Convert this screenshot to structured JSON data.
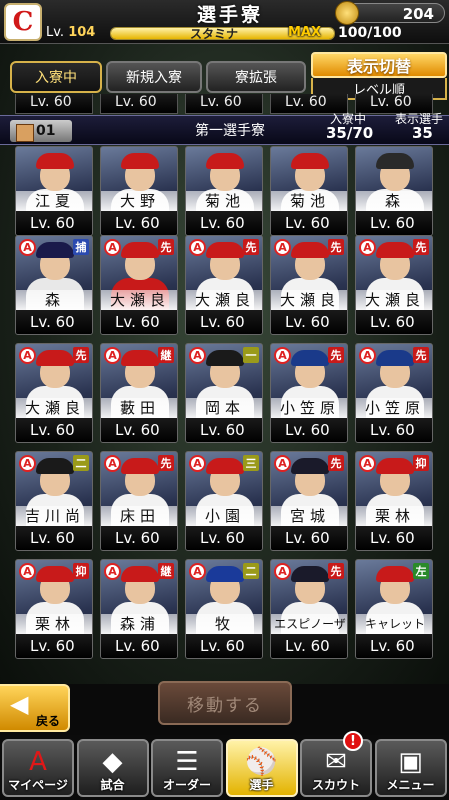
{
  "header": {
    "title": "選手寮",
    "coins": "204",
    "level_label": "Lv.",
    "level_value": "104",
    "stamina_label": "スタミナ",
    "stamina_max_label": "MAX",
    "stamina_value": "100/100",
    "stamina_fraction": 1.0
  },
  "tabs": [
    {
      "label": "入寮中",
      "active": true
    },
    {
      "label": "新規入寮",
      "active": false
    },
    {
      "label": "寮拡張",
      "active": false
    }
  ],
  "display_toggle": {
    "label": "表示切替",
    "sort": "レベル順"
  },
  "previous_row_levels": [
    "Lv. 60",
    "Lv. 60",
    "Lv. 60",
    "Lv. 60",
    "Lv. 60"
  ],
  "dorm": {
    "number": "01",
    "name": "第一選手寮",
    "residents_label": "入寮中",
    "residents_value": "35/70",
    "shown_label": "表示選手",
    "shown_value": "35"
  },
  "rows": [
    [
      {
        "name": "江夏",
        "level": "Lv. 60",
        "badge": "",
        "pos": "",
        "cap": "#c81a1a",
        "uni": "#f2f2f2"
      },
      {
        "name": "大野",
        "level": "Lv. 60",
        "badge": "",
        "pos": "",
        "cap": "#c81a1a",
        "uni": "#f2f2f2"
      },
      {
        "name": "菊池",
        "level": "Lv. 60",
        "badge": "",
        "pos": "",
        "cap": "#c81a1a",
        "uni": "#f2f2f2"
      },
      {
        "name": "菊池",
        "level": "Lv. 60",
        "badge": "",
        "pos": "",
        "cap": "#c81a1a",
        "uni": "#f2f2f2"
      },
      {
        "name": "森",
        "level": "Lv. 60",
        "badge": "",
        "pos": "",
        "cap": "#2a2a2a",
        "uni": "#f2f2f2"
      }
    ],
    [
      {
        "name": "森",
        "level": "Lv. 60",
        "badge": "A",
        "pos": "捕",
        "pos_color": "#2a4ab0",
        "cap": "#1a1a4a",
        "uni": "#e8e8e8"
      },
      {
        "name": "大瀬良",
        "level": "Lv. 60",
        "badge": "A",
        "pos": "先",
        "pos_color": "#c81a1a",
        "cap": "#c81a1a",
        "uni": "#c81a1a"
      },
      {
        "name": "大瀬良",
        "level": "Lv. 60",
        "badge": "A",
        "pos": "先",
        "pos_color": "#c81a1a",
        "cap": "#c81a1a",
        "uni": "#f2f2f2"
      },
      {
        "name": "大瀬良",
        "level": "Lv. 60",
        "badge": "A",
        "pos": "先",
        "pos_color": "#c81a1a",
        "cap": "#c81a1a",
        "uni": "#f2f2f2"
      },
      {
        "name": "大瀬良",
        "level": "Lv. 60",
        "badge": "A",
        "pos": "先",
        "pos_color": "#c81a1a",
        "cap": "#c81a1a",
        "uni": "#f2f2f2"
      }
    ],
    [
      {
        "name": "大瀬良",
        "level": "Lv. 60",
        "badge": "A",
        "pos": "先",
        "pos_color": "#c81a1a",
        "cap": "#c81a1a",
        "uni": "#f2f2f2"
      },
      {
        "name": "藪田",
        "level": "Lv. 60",
        "badge": "A",
        "pos": "継",
        "pos_color": "#c81a1a",
        "cap": "#c81a1a",
        "uni": "#f2f2f2"
      },
      {
        "name": "岡本",
        "level": "Lv. 60",
        "badge": "A",
        "pos": "一",
        "pos_color": "#9a9a1a",
        "cap": "#1a1a1a",
        "uni": "#f2f2f2"
      },
      {
        "name": "小笠原",
        "level": "Lv. 60",
        "badge": "A",
        "pos": "先",
        "pos_color": "#c81a1a",
        "cap": "#1a3a8a",
        "uni": "#f2f2f2"
      },
      {
        "name": "小笠原",
        "level": "Lv. 60",
        "badge": "A",
        "pos": "先",
        "pos_color": "#c81a1a",
        "cap": "#1a3a8a",
        "uni": "#f2f2f2"
      }
    ],
    [
      {
        "name": "吉川尚",
        "level": "Lv. 60",
        "badge": "A",
        "pos": "二",
        "pos_color": "#9a9a1a",
        "cap": "#1a1a1a",
        "uni": "#f2f2f2"
      },
      {
        "name": "床田",
        "level": "Lv. 60",
        "badge": "A",
        "pos": "先",
        "pos_color": "#c81a1a",
        "cap": "#c81a1a",
        "uni": "#f2f2f2"
      },
      {
        "name": "小園",
        "level": "Lv. 60",
        "badge": "A",
        "pos": "三",
        "pos_color": "#9a9a1a",
        "cap": "#c81a1a",
        "uni": "#f2f2f2"
      },
      {
        "name": "宮城",
        "level": "Lv. 60",
        "badge": "A",
        "pos": "先",
        "pos_color": "#c81a1a",
        "cap": "#1a1a2a",
        "uni": "#f2f2f2"
      },
      {
        "name": "栗林",
        "level": "Lv. 60",
        "badge": "A",
        "pos": "抑",
        "pos_color": "#c81a1a",
        "cap": "#c81a1a",
        "uni": "#f2f2f2"
      }
    ],
    [
      {
        "name": "栗林",
        "level": "Lv. 60",
        "badge": "A",
        "pos": "抑",
        "pos_color": "#c81a1a",
        "cap": "#c81a1a",
        "uni": "#f2f2f2"
      },
      {
        "name": "森浦",
        "level": "Lv. 60",
        "badge": "A",
        "pos": "継",
        "pos_color": "#c81a1a",
        "cap": "#c81a1a",
        "uni": "#f2f2f2"
      },
      {
        "name": "牧",
        "level": "Lv. 60",
        "badge": "A",
        "pos": "二",
        "pos_color": "#9a9a1a",
        "cap": "#1a3a9a",
        "uni": "#f2f2f2"
      },
      {
        "name": "エスピノーザ",
        "level": "Lv. 60",
        "badge": "A",
        "pos": "先",
        "pos_color": "#c81a1a",
        "cap": "#1a1a2a",
        "uni": "#f2f2f2"
      },
      {
        "name": "キャレット",
        "level": "Lv. 60",
        "badge": "",
        "pos": "左",
        "pos_color": "#2a8a2a",
        "cap": "#c81a1a",
        "uni": "#f2f2f2"
      }
    ]
  ],
  "buttons": {
    "back": "戻る",
    "move": "移動する"
  },
  "nav": [
    {
      "label": "マイページ",
      "icon": "home-icon",
      "active": false
    },
    {
      "label": "試合",
      "icon": "stadium-icon",
      "active": false
    },
    {
      "label": "オーダー",
      "icon": "order-icon",
      "active": false
    },
    {
      "label": "選手",
      "icon": "player-icon",
      "active": true
    },
    {
      "label": "スカウト",
      "icon": "scout-icon",
      "active": false
    },
    {
      "label": "メニュー",
      "icon": "menu-icon",
      "active": false
    }
  ],
  "notification": "!"
}
